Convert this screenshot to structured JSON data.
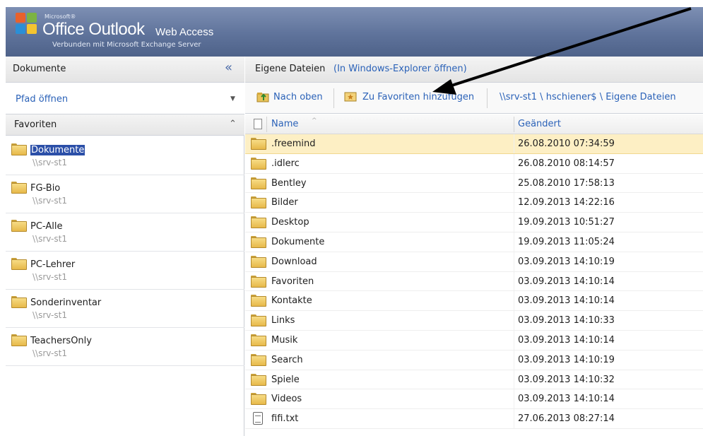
{
  "header": {
    "ms": "Microsoft®",
    "office": "Office Outlook",
    "web_access": "Web Access",
    "subtitle": "Verbunden mit Microsoft Exchange Server"
  },
  "left": {
    "title": "Dokumente",
    "collapse_icon": "«",
    "path_open": "Pfad öffnen",
    "dropdown_icon": "▼",
    "favorites_label": "Favoriten",
    "favorites_collapse_icon": "⌃",
    "favorites": [
      {
        "name": "Dokumente",
        "server": "\\\\srv-st1",
        "selected": true
      },
      {
        "name": "FG-Bio",
        "server": "\\\\srv-st1"
      },
      {
        "name": "PC-Alle",
        "server": "\\\\srv-st1"
      },
      {
        "name": "PC-Lehrer",
        "server": "\\\\srv-st1"
      },
      {
        "name": "Sonderinventar",
        "server": "\\\\srv-st1"
      },
      {
        "name": "TeachersOnly",
        "server": "\\\\srv-st1"
      }
    ]
  },
  "right": {
    "title": "Eigene Dateien",
    "explorer_link": "(In Windows-Explorer öffnen)",
    "toolbar": {
      "up_label": "Nach oben",
      "fav_label": "Zu Favoriten hinzufügen",
      "path": "\\\\srv-st1 \\ hschiener$ \\ Eigene Dateien"
    },
    "columns": {
      "name": "Name",
      "changed": "Geändert",
      "sort_icon": "^"
    },
    "files": [
      {
        "name": ".freemind",
        "changed": "26.08.2010 07:34:59",
        "type": "folder",
        "selected": true
      },
      {
        "name": ".idlerc",
        "changed": "26.08.2010 08:14:57",
        "type": "folder"
      },
      {
        "name": "Bentley",
        "changed": "25.08.2010 17:58:13",
        "type": "folder"
      },
      {
        "name": "Bilder",
        "changed": "12.09.2013 14:22:16",
        "type": "folder"
      },
      {
        "name": "Desktop",
        "changed": "19.09.2013 10:51:27",
        "type": "folder"
      },
      {
        "name": "Dokumente",
        "changed": "19.09.2013 11:05:24",
        "type": "folder"
      },
      {
        "name": "Download",
        "changed": "03.09.2013 14:10:19",
        "type": "folder"
      },
      {
        "name": "Favoriten",
        "changed": "03.09.2013 14:10:14",
        "type": "folder"
      },
      {
        "name": "Kontakte",
        "changed": "03.09.2013 14:10:14",
        "type": "folder"
      },
      {
        "name": "Links",
        "changed": "03.09.2013 14:10:33",
        "type": "folder"
      },
      {
        "name": "Musik",
        "changed": "03.09.2013 14:10:14",
        "type": "folder"
      },
      {
        "name": "Search",
        "changed": "03.09.2013 14:10:19",
        "type": "folder"
      },
      {
        "name": "Spiele",
        "changed": "03.09.2013 14:10:32",
        "type": "folder"
      },
      {
        "name": "Videos",
        "changed": "03.09.2013 14:10:14",
        "type": "folder"
      },
      {
        "name": "fifi.txt",
        "changed": "27.06.2013 08:27:14",
        "type": "text-file"
      }
    ]
  },
  "colors": {
    "header": "#5f739b",
    "link": "#2b62b8",
    "selected_row": "#fdefc4",
    "selected_favorite": "#2b4fa8"
  }
}
